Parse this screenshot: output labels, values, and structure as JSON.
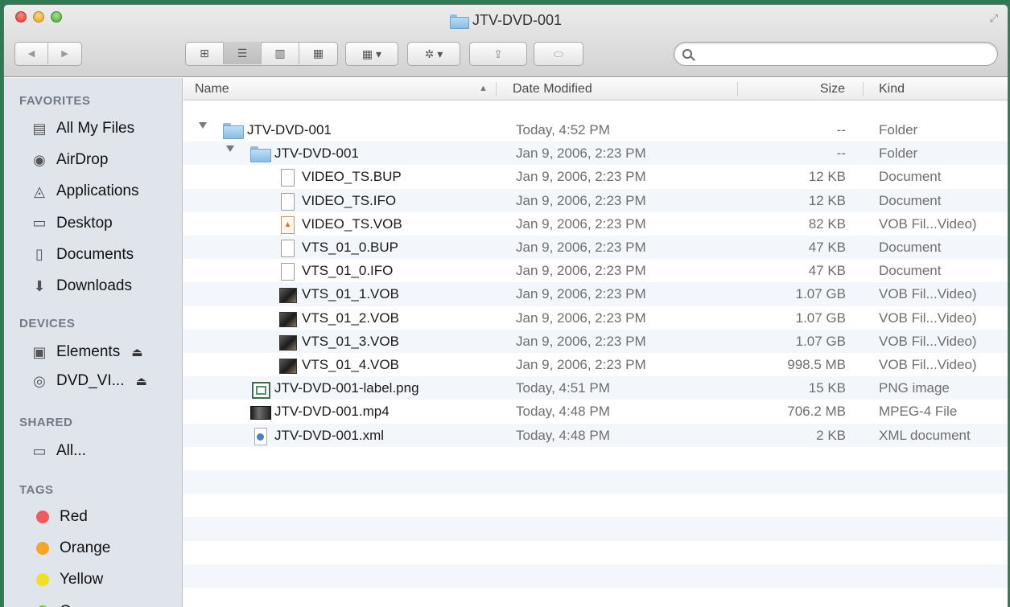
{
  "window": {
    "title": "JTV-DVD-001",
    "fullscreen_icon": "⤢"
  },
  "toolbar": {
    "back_icon": "◀",
    "forward_icon": "▶",
    "view_icons": [
      "⊞",
      "☰",
      "▥",
      "▦"
    ],
    "arrange_icon": "▦ ▾",
    "action_icon": "✲ ▾",
    "share_icon": "⇪",
    "tags_icon": "⬭",
    "search_placeholder": ""
  },
  "sidebar": {
    "favorites_heading": "FAVORITES",
    "favorites": [
      {
        "label": "All My Files",
        "icon": "▤"
      },
      {
        "label": "AirDrop",
        "icon": "◉"
      },
      {
        "label": "Applications",
        "icon": "◬"
      },
      {
        "label": "Desktop",
        "icon": "▭"
      },
      {
        "label": "Documents",
        "icon": "▯"
      },
      {
        "label": "Downloads",
        "icon": "⬇"
      }
    ],
    "devices_heading": "DEVICES",
    "devices": [
      {
        "label": "Elements",
        "icon": "▣",
        "eject": "⏏"
      },
      {
        "label": "DVD_VI...",
        "icon": "◎",
        "eject": "⏏"
      }
    ],
    "shared_heading": "SHARED",
    "shared": [
      {
        "label": "All...",
        "icon": "▭"
      }
    ],
    "tags_heading": "TAGS",
    "tags": [
      {
        "label": "Red",
        "color": "#f25a5a"
      },
      {
        "label": "Orange",
        "color": "#f6a623"
      },
      {
        "label": "Yellow",
        "color": "#f1e01f"
      },
      {
        "label": "Green",
        "color": "#7cc63a"
      }
    ]
  },
  "columns": {
    "name": "Name",
    "sort_indicator": "▲",
    "date": "Date Modified",
    "size": "Size",
    "kind": "Kind"
  },
  "files": [
    {
      "name": "JTV-DVD-001",
      "date": "Today, 4:52 PM",
      "size": "--",
      "kind": "Folder",
      "icon": "folder",
      "level": 0,
      "expanded": true
    },
    {
      "name": "JTV-DVD-001",
      "date": "Jan 9, 2006, 2:23 PM",
      "size": "--",
      "kind": "Folder",
      "icon": "folder",
      "level": 1,
      "expanded": true
    },
    {
      "name": "VIDEO_TS.BUP",
      "date": "Jan 9, 2006, 2:23 PM",
      "size": "12 KB",
      "kind": "Document",
      "icon": "doc",
      "level": 2
    },
    {
      "name": "VIDEO_TS.IFO",
      "date": "Jan 9, 2006, 2:23 PM",
      "size": "12 KB",
      "kind": "Document",
      "icon": "doc",
      "level": 2
    },
    {
      "name": "VIDEO_TS.VOB",
      "date": "Jan 9, 2006, 2:23 PM",
      "size": "82 KB",
      "kind": "VOB Fil...Video)",
      "icon": "vob",
      "level": 2
    },
    {
      "name": "VTS_01_0.BUP",
      "date": "Jan 9, 2006, 2:23 PM",
      "size": "47 KB",
      "kind": "Document",
      "icon": "doc",
      "level": 2
    },
    {
      "name": "VTS_01_0.IFO",
      "date": "Jan 9, 2006, 2:23 PM",
      "size": "47 KB",
      "kind": "Document",
      "icon": "doc",
      "level": 2
    },
    {
      "name": "VTS_01_1.VOB",
      "date": "Jan 9, 2006, 2:23 PM",
      "size": "1.07 GB",
      "kind": "VOB Fil...Video)",
      "icon": "thumb",
      "level": 2
    },
    {
      "name": "VTS_01_2.VOB",
      "date": "Jan 9, 2006, 2:23 PM",
      "size": "1.07 GB",
      "kind": "VOB Fil...Video)",
      "icon": "thumb",
      "level": 2
    },
    {
      "name": "VTS_01_3.VOB",
      "date": "Jan 9, 2006, 2:23 PM",
      "size": "1.07 GB",
      "kind": "VOB Fil...Video)",
      "icon": "thumb",
      "level": 2
    },
    {
      "name": "VTS_01_4.VOB",
      "date": "Jan 9, 2006, 2:23 PM",
      "size": "998.5 MB",
      "kind": "VOB Fil...Video)",
      "icon": "thumb",
      "level": 2
    },
    {
      "name": "JTV-DVD-001-label.png",
      "date": "Today, 4:51 PM",
      "size": "15 KB",
      "kind": "PNG image",
      "icon": "png",
      "level": 1
    },
    {
      "name": "JTV-DVD-001.mp4",
      "date": "Today, 4:48 PM",
      "size": "706.2 MB",
      "kind": "MPEG-4 File",
      "icon": "mp4",
      "level": 1
    },
    {
      "name": "JTV-DVD-001.xml",
      "date": "Today, 4:48 PM",
      "size": "2 KB",
      "kind": "XML document",
      "icon": "xml",
      "level": 1
    }
  ],
  "colors": {
    "stripe": "#f3f6fa",
    "sidebar_bg": "#e0e5ec",
    "header_text": "#707a86"
  }
}
